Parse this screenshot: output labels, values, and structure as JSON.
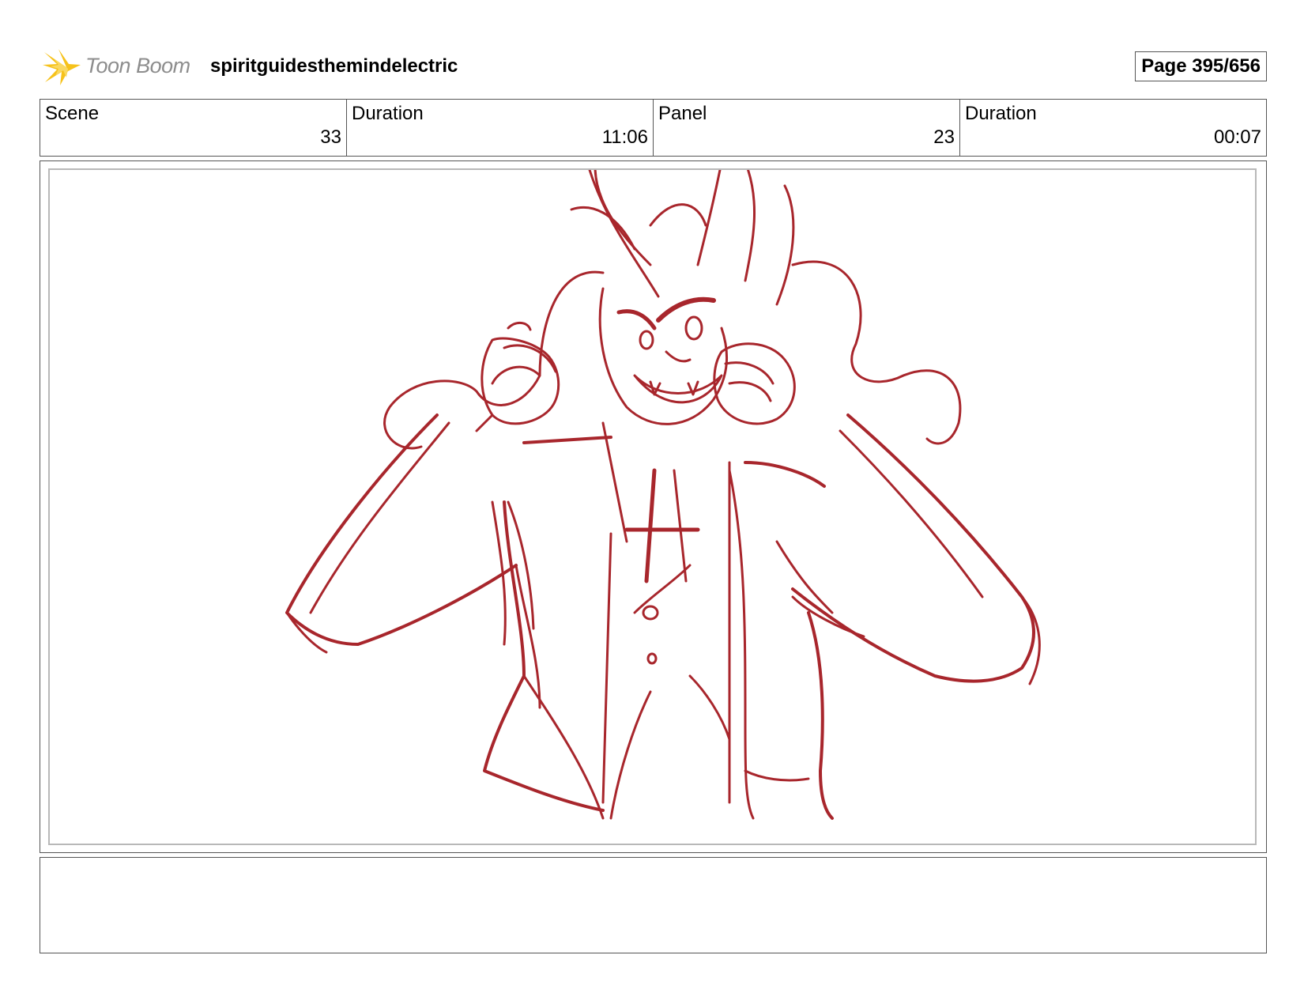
{
  "header": {
    "logo_text": "Toon Boom",
    "project_title": "spiritguidesthemindelectric",
    "page_label": "Page 395/656"
  },
  "info": [
    {
      "label": "Scene",
      "value": "33"
    },
    {
      "label": "Duration",
      "value": "11:06"
    },
    {
      "label": "Panel",
      "value": "23"
    },
    {
      "label": "Duration",
      "value": "00:07"
    }
  ],
  "panel": {
    "sketch_color": "#a8262c",
    "image_description": "Red pencil storyboard sketch of a fanged character grinning, gripping the lapels of his open jacket"
  },
  "notes": {
    "text": ""
  },
  "colors": {
    "logo_star": "#f6c21a",
    "logo_text": "#8d8d8d",
    "frame": "#555555"
  }
}
